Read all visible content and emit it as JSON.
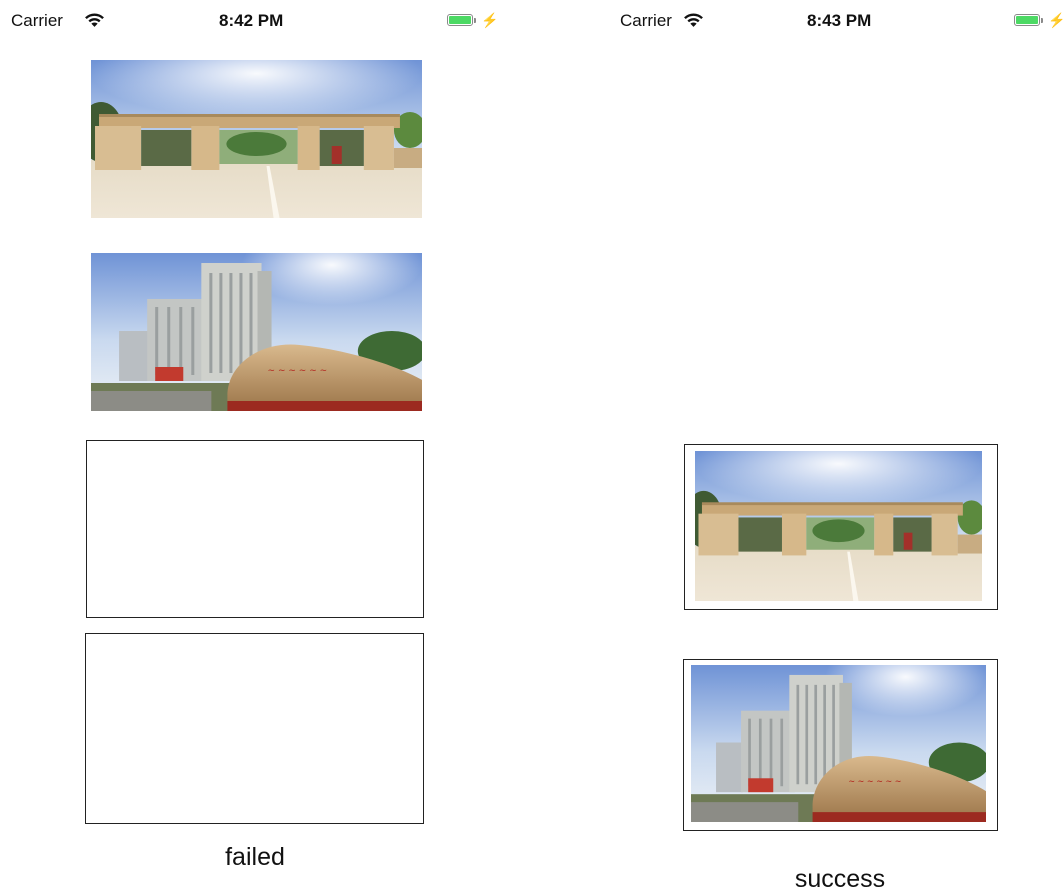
{
  "left_screen": {
    "status_bar": {
      "carrier": "Carrier",
      "time": "8:42 PM"
    },
    "caption": "failed"
  },
  "right_screen": {
    "status_bar": {
      "carrier": "Carrier",
      "time": "8:43 PM"
    },
    "caption": "success"
  },
  "colors": {
    "battery_fill": "#4cd964",
    "frame_border": "#222222"
  }
}
